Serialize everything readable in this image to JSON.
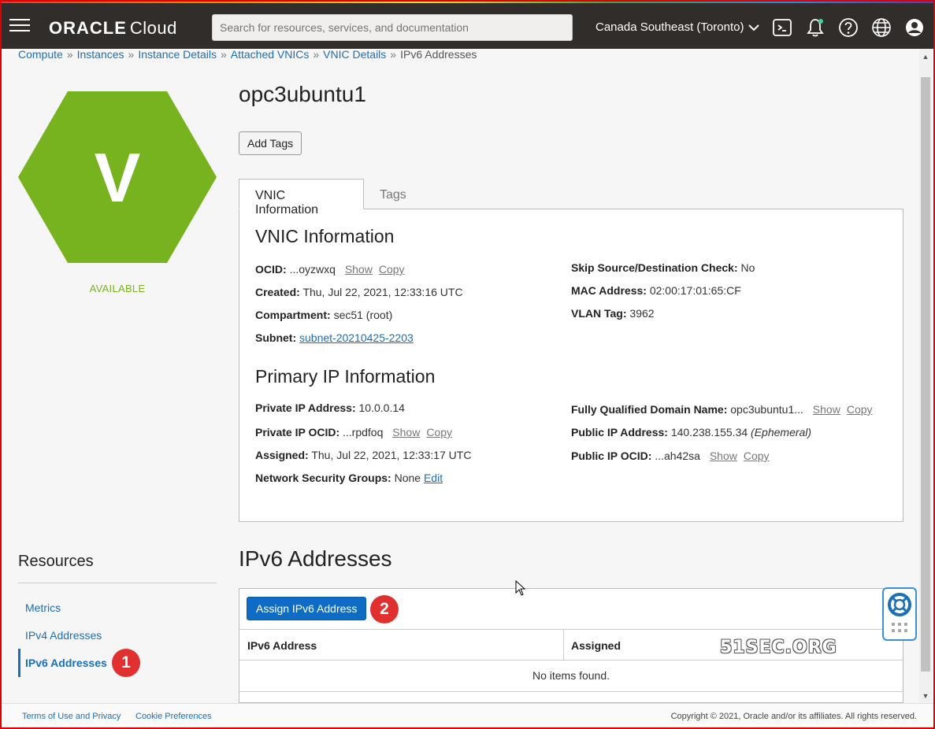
{
  "header": {
    "brand_bold": "ORACLE",
    "brand_light": "Cloud",
    "search_placeholder": "Search for resources, services, and documentation",
    "region": "Canada Southeast (Toronto)"
  },
  "breadcrumb": [
    "Compute",
    "Instances",
    "Instance Details",
    "Attached VNICs",
    "VNIC Details",
    "IPv6 Addresses"
  ],
  "resource_icon": {
    "letter": "V",
    "color": "#77b31f",
    "status": "AVAILABLE"
  },
  "page": {
    "title": "opc3ubuntu1",
    "add_tags_label": "Add Tags",
    "tabs": [
      "VNIC Information",
      "Tags"
    ]
  },
  "vnic_info": {
    "heading": "VNIC Information",
    "ocid_key": "OCID:",
    "ocid_value": "...oyzwxq",
    "created_key": "Created:",
    "created_value": "Thu, Jul 22, 2021, 12:33:16 UTC",
    "compartment_key": "Compartment:",
    "compartment_value": "sec51 (root)",
    "subnet_key": "Subnet:",
    "subnet_value": "subnet-20210425-2203",
    "skip_key": "Skip Source/Destination Check:",
    "skip_value": "No",
    "mac_key": "MAC Address:",
    "mac_value": "02:00:17:01:65:CF",
    "vlan_key": "VLAN Tag:",
    "vlan_value": "3962"
  },
  "primary_ip": {
    "heading": "Primary IP Information",
    "private_ip_key": "Private IP Address:",
    "private_ip_value": "10.0.0.14",
    "private_ocid_key": "Private IP OCID:",
    "private_ocid_value": "...rpdfoq",
    "assigned_key": "Assigned:",
    "assigned_value": "Thu, Jul 22, 2021, 12:33:17 UTC",
    "nsg_key": "Network Security Groups:",
    "nsg_value": "None",
    "nsg_edit": "Edit",
    "fqdn_key": "Fully Qualified Domain Name:",
    "fqdn_value": "opc3ubuntu1...",
    "public_ip_key": "Public IP Address:",
    "public_ip_value": "140.238.155.34",
    "public_ip_type": "(Ephemeral)",
    "public_ocid_key": "Public IP OCID:",
    "public_ocid_value": "...ah42sa"
  },
  "actions": {
    "show": "Show",
    "copy": "Copy"
  },
  "resources": {
    "heading": "Resources",
    "items": [
      "Metrics",
      "IPv4 Addresses",
      "IPv6 Addresses"
    ],
    "active": "IPv6 Addresses"
  },
  "ipv6": {
    "heading": "IPv6 Addresses",
    "assign_label": "Assign IPv6 Address",
    "columns": [
      "IPv6 Address",
      "Assigned"
    ],
    "empty_text": "No items found."
  },
  "annotations": {
    "badge1": "1",
    "badge2": "2",
    "watermark": "51SEC.ORG"
  },
  "footer": {
    "terms": "Terms of Use and Privacy",
    "cookies": "Cookie Preferences",
    "copyright": "Copyright © 2021, Oracle and/or its affiliates. All rights reserved."
  }
}
